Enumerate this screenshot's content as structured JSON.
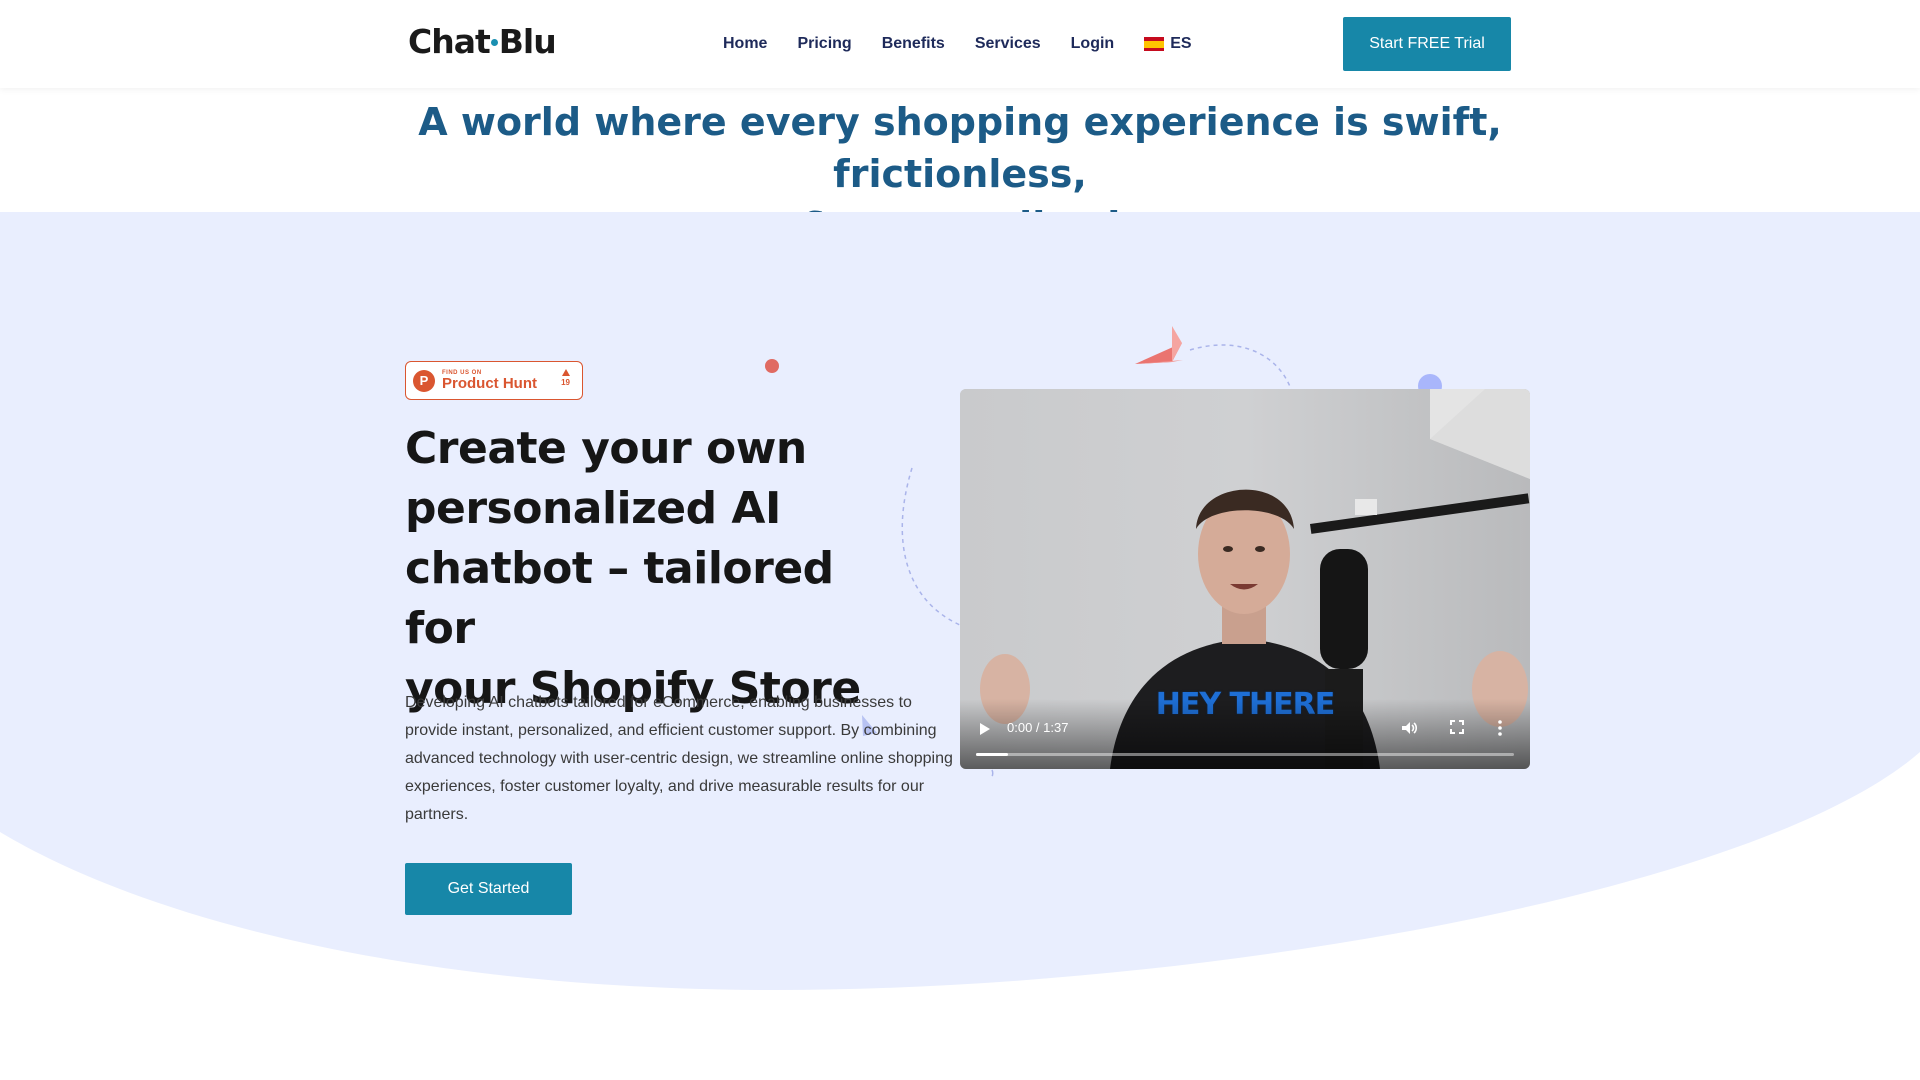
{
  "header": {
    "logo": {
      "part1": "Chat",
      "part2": "Blu"
    },
    "nav": [
      "Home",
      "Pricing",
      "Benefits",
      "Services",
      "Login"
    ],
    "language": "ES",
    "cta": "Start FREE Trial"
  },
  "banner": {
    "line1": "A world where every shopping experience is swift, frictionless,",
    "line2": "& personalized"
  },
  "hero": {
    "badge": {
      "small": "FIND US ON",
      "big": "Product Hunt",
      "votes": "19"
    },
    "title_lines": [
      "Create your own",
      "personalized AI",
      "chatbot – tailored for",
      "your Shopify Store"
    ],
    "description_lines": [
      "Developing AI chatbots tailored for eCommerce, enabling businesses to",
      "provide instant, personalized, and efficient customer support. By combining",
      "advanced technology with user-centric design, we streamline online shopping",
      "experiences, foster customer loyalty, and drive measurable results for our",
      "partners."
    ],
    "cta": "Get Started"
  },
  "video": {
    "caption": "HEY THERE",
    "time": "0:00 / 1:37",
    "progress": 0.06
  },
  "colors": {
    "accent": "#1787a8",
    "heading_blue": "#1c5b87",
    "nav_text": "#1e2a5a",
    "hero_bg": "#e9eefe",
    "product_hunt": "#da5630"
  },
  "icons": [
    "spain-flag-icon",
    "product-hunt-icon",
    "upvote-arrow-icon",
    "play-icon",
    "volume-icon",
    "fullscreen-icon",
    "more-options-icon",
    "paper-plane-icon"
  ]
}
